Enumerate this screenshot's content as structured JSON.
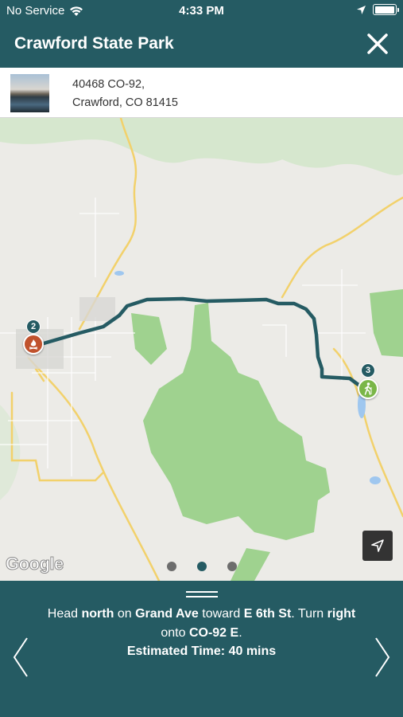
{
  "status_bar": {
    "carrier": "No Service",
    "time": "4:33 PM"
  },
  "header": {
    "title": "Crawford State Park"
  },
  "address": {
    "line1": "40468 CO-92,",
    "line2": "Crawford, CO 81415"
  },
  "map": {
    "attribution": "Google",
    "markers": [
      {
        "number": "2",
        "icon": "campfire-icon",
        "color": "#c0522d"
      },
      {
        "number": "3",
        "icon": "hiker-icon",
        "color": "#7ab648"
      }
    ],
    "route_color": "#255b63",
    "page_dots": {
      "count": 3,
      "active": 2
    }
  },
  "directions": {
    "w1": "Head ",
    "b1": "north",
    "w2": " on ",
    "b2": "Grand Ave",
    "w3": " toward ",
    "b3": "E 6th St",
    "w4": ". Turn ",
    "b4": "right",
    "w5": " onto ",
    "b5": "CO-92 E",
    "w6": ".",
    "estimate": "Estimated Time: 40 mins"
  },
  "colors": {
    "brand": "#255b63",
    "park_green": "#9fd28f",
    "road_yellow": "#f2d16b"
  }
}
